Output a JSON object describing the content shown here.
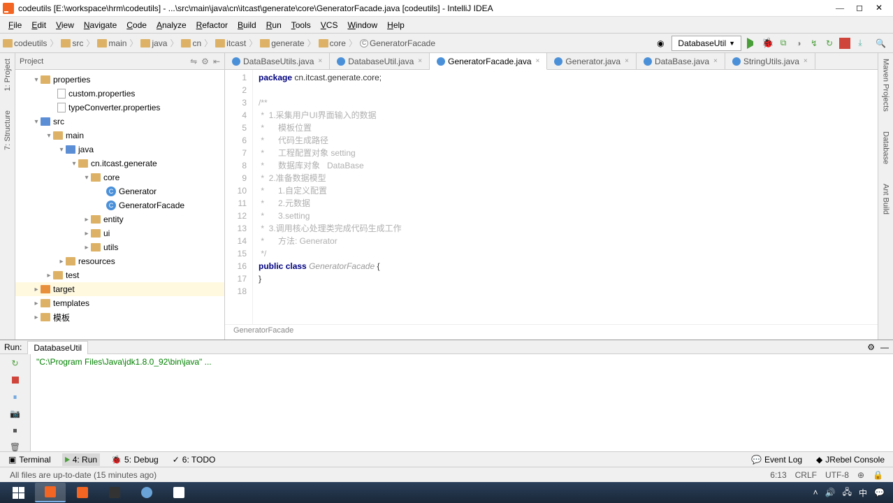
{
  "window": {
    "title": "codeutils [E:\\workspace\\hrm\\codeutils] - ...\\src\\main\\java\\cn\\itcast\\generate\\core\\GeneratorFacade.java [codeutils] - IntelliJ IDEA"
  },
  "menu": [
    "File",
    "Edit",
    "View",
    "Navigate",
    "Code",
    "Analyze",
    "Refactor",
    "Build",
    "Run",
    "Tools",
    "VCS",
    "Window",
    "Help"
  ],
  "breadcrumbs": [
    "codeutils",
    "src",
    "main",
    "java",
    "cn",
    "itcast",
    "generate",
    "core",
    "GeneratorFacade"
  ],
  "runConfig": "DatabaseUtil",
  "leftTools": [
    "1: Project",
    "7: Structure"
  ],
  "rightTools": [
    "Maven Projects",
    "Database",
    "Ant Build"
  ],
  "projectPanel": {
    "title": "Project"
  },
  "tree": {
    "properties": "properties",
    "custom": "custom.properties",
    "typeConverter": "typeConverter.properties",
    "src": "src",
    "main": "main",
    "java": "java",
    "pkg": "cn.itcast.generate",
    "core": "core",
    "generator": "Generator",
    "generatorFacade": "GeneratorFacade",
    "entity": "entity",
    "ui": "ui",
    "utils": "utils",
    "resources": "resources",
    "test": "test",
    "target": "target",
    "templates": "templates",
    "muban": "模板"
  },
  "tabs": [
    {
      "label": "DataBaseUtils.java",
      "active": false
    },
    {
      "label": "DatabaseUtil.java",
      "active": false
    },
    {
      "label": "GeneratorFacade.java",
      "active": true
    },
    {
      "label": "Generator.java",
      "active": false
    },
    {
      "label": "DataBase.java",
      "active": false
    },
    {
      "label": "StringUtils.java",
      "active": false
    }
  ],
  "code": {
    "lines": [
      {
        "n": 1,
        "html": "<span class='kw'>package</span> cn.itcast.generate.core;"
      },
      {
        "n": 2,
        "html": ""
      },
      {
        "n": 3,
        "html": "<span class='comment'>/**</span>"
      },
      {
        "n": 4,
        "html": "<span class='comment'> *  1.采集用户UI界面输入的数据</span>"
      },
      {
        "n": 5,
        "html": "<span class='comment'> *      模板位置</span>"
      },
      {
        "n": 6,
        "html": "<span class='comment'> *      代码生成路径</span>"
      },
      {
        "n": 7,
        "html": "<span class='comment'> *      工程配置对象 setting</span>"
      },
      {
        "n": 8,
        "html": "<span class='comment'> *      数据库对象   DataBase</span>"
      },
      {
        "n": 9,
        "html": "<span class='comment'> *  2.准备数据模型</span>"
      },
      {
        "n": 10,
        "html": "<span class='comment'> *      1.自定义配置</span>"
      },
      {
        "n": 11,
        "html": "<span class='comment'> *      2.元数据</span>"
      },
      {
        "n": 12,
        "html": "<span class='comment'> *      3.setting</span>"
      },
      {
        "n": 13,
        "html": "<span class='comment'> *  3.调用核心处理类完成代码生成工作</span>"
      },
      {
        "n": 14,
        "html": "<span class='comment'> *      方法: Generator</span>"
      },
      {
        "n": 15,
        "html": "<span class='comment'> */</span>"
      },
      {
        "n": 16,
        "html": "<span class='kw'>public</span> <span class='kw'>class</span> <span class='classname'>GeneratorFacade</span> {"
      },
      {
        "n": 17,
        "html": "}"
      },
      {
        "n": 18,
        "html": ""
      }
    ],
    "crumb": "GeneratorFacade"
  },
  "run": {
    "tabLabel": "Run:",
    "activeTab": "DatabaseUtil",
    "output": "\"C:\\Program Files\\Java\\jdk1.8.0_92\\bin\\java\" ..."
  },
  "bottomTabs": {
    "terminal": "Terminal",
    "run": "4: Run",
    "debug": "5: Debug",
    "todo": "6: TODO",
    "eventLog": "Event Log",
    "jrebel": "JRebel Console"
  },
  "status": {
    "message": "All files are up-to-date (15 minutes ago)",
    "pos": "6:13",
    "eol": "CRLF",
    "encoding": "UTF-8",
    "insert": "⊕"
  },
  "tray": {
    "time": ""
  }
}
